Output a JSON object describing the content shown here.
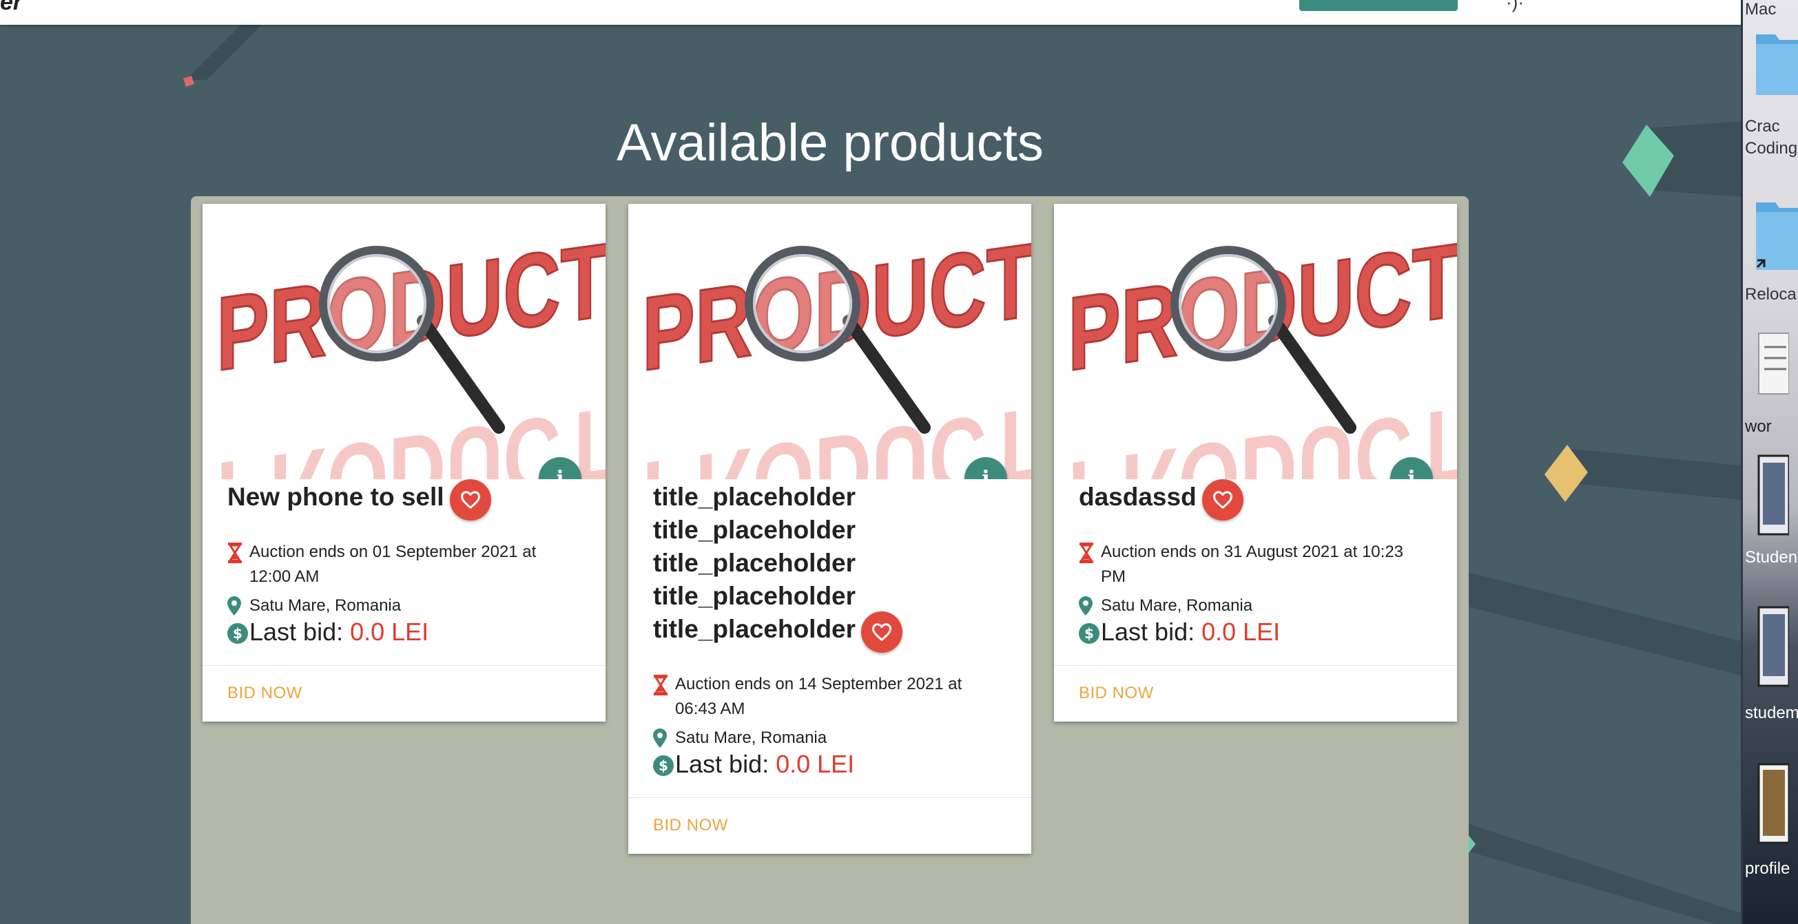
{
  "topbar": {
    "brand_fragment": "er"
  },
  "page": {
    "title": "Available products"
  },
  "product_image": {
    "word": "PRODUCT",
    "word_color": "#d9534f",
    "reflection_color": "#f2b6b3"
  },
  "cards": [
    {
      "title": "New phone to sell",
      "auction": "Auction ends on 01 September 2021 at 12:00 AM",
      "location": "Satu Mare, Romania",
      "bid_label": "Last bid:",
      "bid_value": "0.0 LEI",
      "action": "BID NOW"
    },
    {
      "title": "title_placeholder title_placeholder title_placeholder title_placeholder title_placeholder",
      "auction": "Auction ends on 14 September 2021 at 06:43 AM",
      "location": "Satu Mare, Romania",
      "bid_label": "Last bid:",
      "bid_value": "0.0 LEI",
      "action": "BID NOW"
    },
    {
      "title": "dasdassd",
      "auction": "Auction ends on 31 August 2021 at 10:23 PM",
      "location": "Satu Mare, Romania",
      "bid_label": "Last bid:",
      "bid_value": "0.0 LEI",
      "action": "BID NOW"
    }
  ],
  "desktop": {
    "items": [
      {
        "label": "Mac"
      },
      {
        "label": "Crac"
      },
      {
        "label": "Coding"
      },
      {
        "label": "Reloca"
      },
      {
        "label": "wor"
      },
      {
        "label": "Studen"
      },
      {
        "label": "studem"
      },
      {
        "label": "profile"
      }
    ]
  },
  "colors": {
    "background": "#475e66",
    "panel": "#b3b8a8",
    "accent_teal": "#3d8b7d",
    "favorite_red": "#e2493d",
    "bid_red": "#e2392b",
    "action_orange": "#eea43c"
  }
}
